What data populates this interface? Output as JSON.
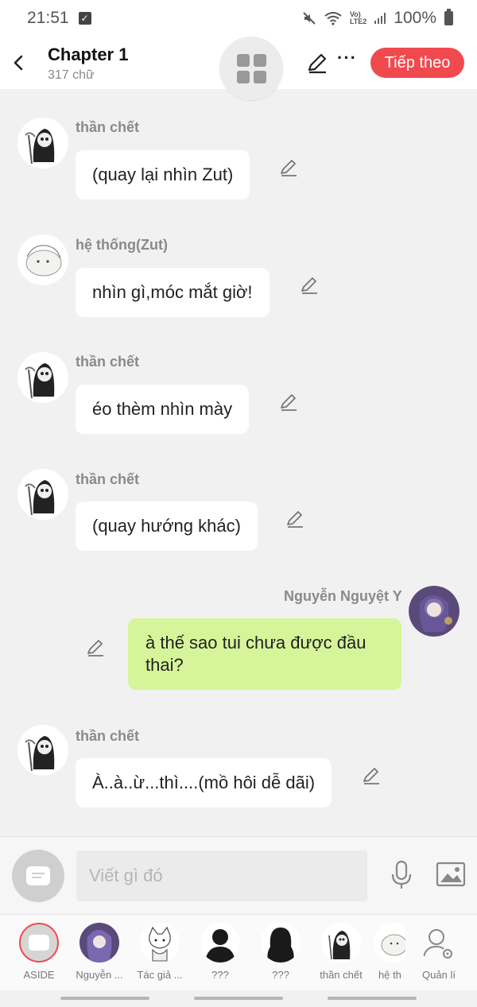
{
  "status": {
    "time": "21:51",
    "battery": "100%"
  },
  "header": {
    "title": "Chapter 1",
    "subtitle": "317 chữ",
    "next_label": "Tiếp theo",
    "more_label": "···"
  },
  "messages": [
    {
      "sender": "thần chết",
      "text": "(quay lại nhìn Zut)"
    },
    {
      "sender": "hệ thống(Zut)",
      "text": "nhìn gì,móc mắt giờ!"
    },
    {
      "sender": "thần chết",
      "text": "éo thèm nhìn mày"
    },
    {
      "sender": "thần chết",
      "text": "(quay hướng khác)"
    },
    {
      "sender": "Nguyễn Nguyệt Y",
      "text": "à thế sao tui chưa được đầu thai?"
    },
    {
      "sender": "thần chết",
      "text": "À..à..ừ...thì....(mồ hôi dễ dãi)"
    }
  ],
  "composer": {
    "placeholder": "Viết gì đó"
  },
  "characters": [
    {
      "name": "ASIDE"
    },
    {
      "name": "Nguyễn ..."
    },
    {
      "name": "Tác giả ..."
    },
    {
      "name": "???"
    },
    {
      "name": "???"
    },
    {
      "name": "thần chết"
    },
    {
      "name": "hệ th"
    },
    {
      "name": "Quản lí"
    }
  ],
  "colors": {
    "accent": "#f04a4f",
    "mine_bubble": "#d6f59a",
    "background": "#f1f1f1"
  }
}
